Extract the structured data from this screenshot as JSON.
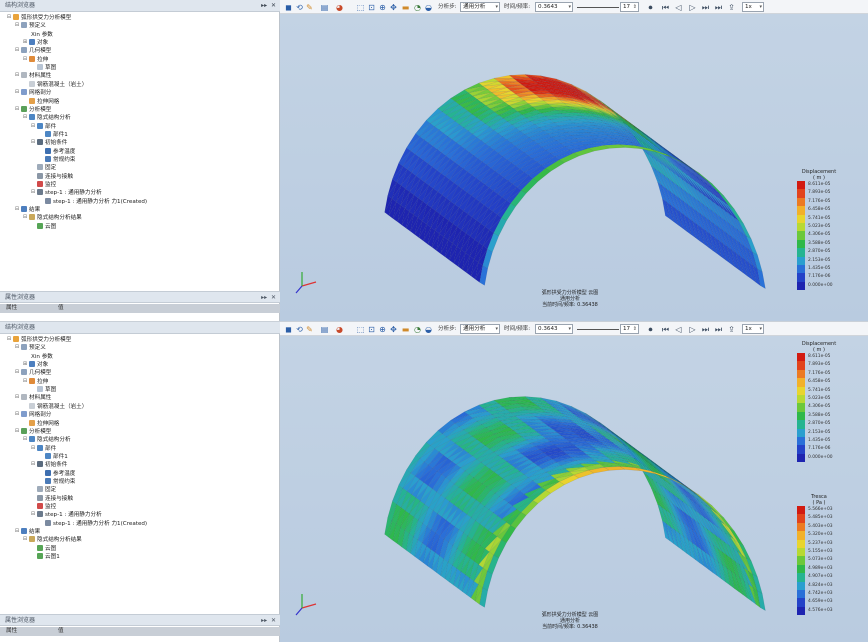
{
  "panes": [
    {
      "browser_title": "结构浏览器",
      "prop_title": "属性浏览器",
      "prop_columns": [
        "属性",
        "值"
      ],
      "tree": [
        {
          "indent": 0,
          "exp": "⊟",
          "icon": "#e9a33b",
          "label": "弧形拱受力分析模型"
        },
        {
          "indent": 1,
          "exp": "⊟",
          "icon": "#8da2bd",
          "label": "预定义"
        },
        {
          "indent": 2,
          "exp": "",
          "icon": "",
          "label": "Xin 参数"
        },
        {
          "indent": 2,
          "exp": "⊞",
          "icon": "#4d7fbf",
          "label": "对象"
        },
        {
          "indent": 1,
          "exp": "⊟",
          "icon": "#8da2bd",
          "label": "几何模型"
        },
        {
          "indent": 2,
          "exp": "⊟",
          "icon": "#e08b3a",
          "label": "拉伸"
        },
        {
          "indent": 3,
          "exp": "",
          "icon": "#b7c4d4",
          "label": "草图"
        },
        {
          "indent": 1,
          "exp": "⊟",
          "icon": "#b0b7c0",
          "label": "材料属性"
        },
        {
          "indent": 2,
          "exp": "",
          "icon": "#c9cfd6",
          "label": "钢筋混凝土（岩土）"
        },
        {
          "indent": 1,
          "exp": "⊟",
          "icon": "#7f9ccc",
          "label": "网格剖分"
        },
        {
          "indent": 2,
          "exp": "",
          "icon": "#e3a04a",
          "label": "拉伸网格"
        },
        {
          "indent": 1,
          "exp": "⊟",
          "icon": "#5aa05a",
          "label": "分析模型"
        },
        {
          "indent": 2,
          "exp": "⊟",
          "icon": "#4d86c4",
          "label": "隐式结构分析"
        },
        {
          "indent": 3,
          "exp": "⊟",
          "icon": "#4d86c4",
          "label": "部件"
        },
        {
          "indent": 4,
          "exp": "",
          "icon": "#4d86c4",
          "label": "部件1"
        },
        {
          "indent": 3,
          "exp": "⊟",
          "icon": "#5a6b7e",
          "label": "初始条件"
        },
        {
          "indent": 4,
          "exp": "",
          "icon": "#3e6fb0",
          "label": "参考温度"
        },
        {
          "indent": 4,
          "exp": "",
          "icon": "#4b7bb8",
          "label": "常规约束"
        },
        {
          "indent": 3,
          "exp": "",
          "icon": "#9eabba",
          "label": "固定"
        },
        {
          "indent": 3,
          "exp": "",
          "icon": "#8a97a6",
          "label": "连接与接触"
        },
        {
          "indent": 3,
          "exp": "",
          "icon": "#d14a4a",
          "label": "监控"
        },
        {
          "indent": 3,
          "exp": "⊟",
          "icon": "#6b7a8c",
          "label": "step-1 : 通用静力分析"
        },
        {
          "indent": 4,
          "exp": "",
          "icon": "#7b8aa0",
          "label": "step-1 : 通用静力分析 力1(Created)"
        },
        {
          "indent": 1,
          "exp": "⊟",
          "icon": "#4d7fbf",
          "label": "结果"
        },
        {
          "indent": 2,
          "exp": "⊟",
          "icon": "#c9a85a",
          "label": "隐式结构分析结果"
        },
        {
          "indent": 3,
          "exp": "",
          "icon": "#56a556",
          "label": "云图"
        }
      ],
      "toolbar": {
        "step_label": "分析步:",
        "step_value": "通用分析",
        "time_label": "时间/频率:",
        "time_value": "0.3643",
        "frame_value": "17",
        "speed_value": "1x"
      },
      "legends": [
        {
          "title_line1": "Displacement",
          "title_line2": "( m )",
          "values": [
            "8.611e-05",
            "7.893e-05",
            "7.176e-05",
            "6.458e-05",
            "5.741e-05",
            "5.023e-05",
            "4.306e-05",
            "3.588e-05",
            "2.870e-05",
            "2.153e-05",
            "1.435e-05",
            "7.176e-06",
            "0.000e+00"
          ],
          "colors": [
            "#d21a10",
            "#e2431b",
            "#ec7a22",
            "#f2b12a",
            "#e8d52e",
            "#b8d933",
            "#6cc83a",
            "#2fb849",
            "#25b491",
            "#2a9fcf",
            "#2a6fd8",
            "#2442c8",
            "#1e24b0"
          ]
        }
      ],
      "caption": [
        "弧形拱受力分析模型 云图",
        "通用分析",
        "当前时间/频率: 0.36438"
      ]
    },
    {
      "browser_title": "结构浏览器",
      "prop_title": "属性浏览器",
      "prop_columns": [
        "属性",
        "值"
      ],
      "tree": [
        {
          "indent": 0,
          "exp": "⊟",
          "icon": "#e9a33b",
          "label": "弧形拱受力分析模型"
        },
        {
          "indent": 1,
          "exp": "⊟",
          "icon": "#8da2bd",
          "label": "预定义"
        },
        {
          "indent": 2,
          "exp": "",
          "icon": "",
          "label": "Xin 参数"
        },
        {
          "indent": 2,
          "exp": "⊞",
          "icon": "#4d7fbf",
          "label": "对象"
        },
        {
          "indent": 1,
          "exp": "⊟",
          "icon": "#8da2bd",
          "label": "几何模型"
        },
        {
          "indent": 2,
          "exp": "⊟",
          "icon": "#e08b3a",
          "label": "拉伸"
        },
        {
          "indent": 3,
          "exp": "",
          "icon": "#b7c4d4",
          "label": "草图"
        },
        {
          "indent": 1,
          "exp": "⊟",
          "icon": "#b0b7c0",
          "label": "材料属性"
        },
        {
          "indent": 2,
          "exp": "",
          "icon": "#c9cfd6",
          "label": "钢筋混凝土（岩土）"
        },
        {
          "indent": 1,
          "exp": "⊟",
          "icon": "#7f9ccc",
          "label": "网格剖分"
        },
        {
          "indent": 2,
          "exp": "",
          "icon": "#e3a04a",
          "label": "拉伸网格"
        },
        {
          "indent": 1,
          "exp": "⊟",
          "icon": "#5aa05a",
          "label": "分析模型"
        },
        {
          "indent": 2,
          "exp": "⊟",
          "icon": "#4d86c4",
          "label": "隐式结构分析"
        },
        {
          "indent": 3,
          "exp": "⊟",
          "icon": "#4d86c4",
          "label": "部件"
        },
        {
          "indent": 4,
          "exp": "",
          "icon": "#4d86c4",
          "label": "部件1"
        },
        {
          "indent": 3,
          "exp": "⊟",
          "icon": "#5a6b7e",
          "label": "初始条件"
        },
        {
          "indent": 4,
          "exp": "",
          "icon": "#3e6fb0",
          "label": "参考温度"
        },
        {
          "indent": 4,
          "exp": "",
          "icon": "#4b7bb8",
          "label": "常规约束"
        },
        {
          "indent": 3,
          "exp": "",
          "icon": "#9eabba",
          "label": "固定"
        },
        {
          "indent": 3,
          "exp": "",
          "icon": "#8a97a6",
          "label": "连接与接触"
        },
        {
          "indent": 3,
          "exp": "",
          "icon": "#d14a4a",
          "label": "监控"
        },
        {
          "indent": 3,
          "exp": "⊟",
          "icon": "#6b7a8c",
          "label": "step-1 : 通用静力分析"
        },
        {
          "indent": 4,
          "exp": "",
          "icon": "#7b8aa0",
          "label": "step-1 : 通用静力分析 力1(Created)"
        },
        {
          "indent": 1,
          "exp": "⊟",
          "icon": "#4d7fbf",
          "label": "结果"
        },
        {
          "indent": 2,
          "exp": "⊟",
          "icon": "#c9a85a",
          "label": "隐式结构分析结果"
        },
        {
          "indent": 3,
          "exp": "",
          "icon": "#56a556",
          "label": "云图"
        },
        {
          "indent": 3,
          "exp": "",
          "icon": "#56a556",
          "label": "云图1"
        }
      ],
      "toolbar": {
        "step_label": "分析步:",
        "step_value": "通用分析",
        "time_label": "时间/频率:",
        "time_value": "0.3643",
        "frame_value": "17",
        "speed_value": "1x"
      },
      "legends": [
        {
          "title_line1": "Displacement",
          "title_line2": "( m )",
          "values": [
            "8.611e-05",
            "7.893e-05",
            "7.176e-05",
            "6.458e-05",
            "5.741e-05",
            "5.023e-05",
            "4.306e-05",
            "3.588e-05",
            "2.870e-05",
            "2.153e-05",
            "1.435e-05",
            "7.176e-06",
            "0.000e+00"
          ],
          "colors": [
            "#d21a10",
            "#e2431b",
            "#ec7a22",
            "#f2b12a",
            "#e8d52e",
            "#b8d933",
            "#6cc83a",
            "#2fb849",
            "#25b491",
            "#2a9fcf",
            "#2a6fd8",
            "#2442c8",
            "#1e24b0"
          ]
        },
        {
          "title_line1": "Tresca",
          "title_line2": "( Pa )",
          "values": [
            "5.566e+03",
            "5.485e+03",
            "5.403e+03",
            "5.320e+03",
            "5.237e+03",
            "5.155e+03",
            "5.073e+03",
            "4.989e+03",
            "4.907e+03",
            "4.824e+03",
            "4.742e+03",
            "4.659e+03",
            "4.576e+03"
          ],
          "colors": [
            "#d21a10",
            "#e2431b",
            "#ec7a22",
            "#f2b12a",
            "#e8d52e",
            "#b8d933",
            "#6cc83a",
            "#2fb849",
            "#25b491",
            "#2a9fcf",
            "#2a6fd8",
            "#2442c8",
            "#1e24b0"
          ]
        }
      ],
      "caption": [
        "弧形拱受力分析模型 云图",
        "通用分析",
        "当前时间/频率: 0.36438"
      ]
    }
  ]
}
